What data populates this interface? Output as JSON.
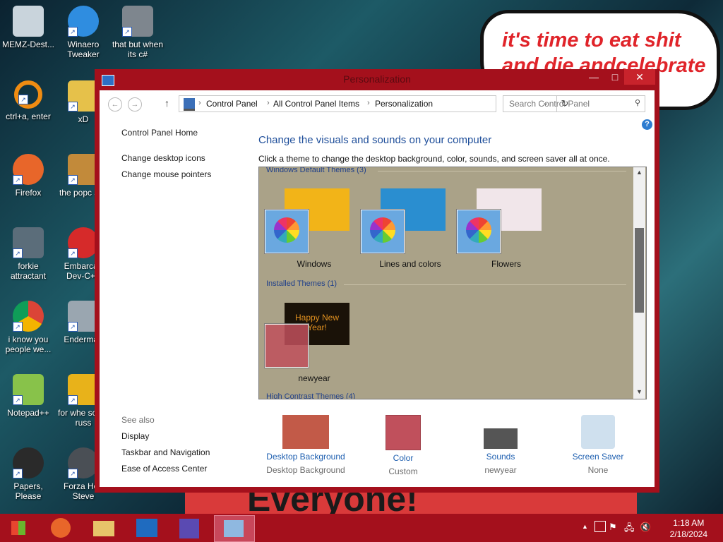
{
  "desktop": {
    "bubble_text": "it's time to eat shit and die andcelebrate",
    "banner_text": "Everyone!",
    "icons": [
      {
        "label": "MEMZ-Dest...",
        "color": "#c9d4dc"
      },
      {
        "label": "Winaero Tweaker",
        "color": "#2f8de0"
      },
      {
        "label": "that but when its c#",
        "color": "#7e868e"
      },
      {
        "label": "ctrl+a, enter",
        "color": "#f08c12"
      },
      {
        "label": "xD",
        "color": "#e6c14a"
      },
      {
        "label": "Firefox",
        "color": "#e8662a"
      },
      {
        "label": "the popc shit",
        "color": "#c28a3a"
      },
      {
        "label": "forkie attractant",
        "color": "#5b6d7a"
      },
      {
        "label": "Embarcad Dev-C++",
        "color": "#d62a2a"
      },
      {
        "label": "i know you people we...",
        "color": "#3ca24a"
      },
      {
        "label": "Enderman",
        "color": "#9aa6b0"
      },
      {
        "label": "Notepad++",
        "color": "#88c24a"
      },
      {
        "label": "for whe some russ",
        "color": "#e8b21a"
      },
      {
        "label": "Papers, Please",
        "color": "#2a2a2a"
      },
      {
        "label": "Forza Hori Steve",
        "color": "#4a4f55"
      }
    ]
  },
  "window": {
    "title": "Personalization",
    "minimize_glyph": "—",
    "maximize_glyph": "□",
    "close_glyph": "✕",
    "back_glyph": "←",
    "forward_glyph": "→",
    "up_glyph": "↑",
    "refresh_glyph": "↻",
    "dropdown_glyph": "⌄",
    "breadcrumb": [
      "Control Panel",
      "All Control Panel Items",
      "Personalization"
    ],
    "breadcrumb_sep": "›",
    "search_placeholder": "Search Control Panel",
    "search_glyph": "⚲",
    "help_glyph": "?",
    "left_nav": {
      "home": "Control Panel Home",
      "items": [
        "Change desktop icons",
        "Change mouse pointers"
      ]
    },
    "see_also": {
      "heading": "See also",
      "items": [
        "Display",
        "Taskbar and Navigation",
        "Ease of Access Center"
      ]
    },
    "heading": "Change the visuals and sounds on your computer",
    "subtext": "Click a theme to change the desktop background, color, sounds, and screen saver all at once.",
    "theme_groups": {
      "default_label": "Windows Default Themes (3)",
      "installed_label": "Installed Themes (1)",
      "high_contrast_label": "High Contrast Themes (4)"
    },
    "themes": [
      {
        "name": "Windows",
        "swatch": "#6aa8e0",
        "bg": "#f2b418"
      },
      {
        "name": "Lines and colors",
        "swatch": "#6aa8e0",
        "bg": "#2a8ed0"
      },
      {
        "name": "Flowers",
        "swatch": "#6aa8e0",
        "bg": "#f1e6ea"
      },
      {
        "name": "newyear",
        "swatch": "#c0505c",
        "bg": "#1a1208"
      }
    ],
    "newyear_text": "Happy New Year!",
    "scroll_up": "▲",
    "scroll_down": "▼",
    "bottom_items": [
      {
        "label": "Desktop Background",
        "value": "Desktop Background"
      },
      {
        "label": "Color",
        "value": "Custom"
      },
      {
        "label": "Sounds",
        "value": "newyear"
      },
      {
        "label": "Screen Saver",
        "value": "None"
      }
    ]
  },
  "taskbar": {
    "time": "1:18 AM",
    "date": "2/18/2024",
    "tray_glyphs": [
      "▲",
      "⚑",
      "🖧",
      "🔇"
    ]
  }
}
